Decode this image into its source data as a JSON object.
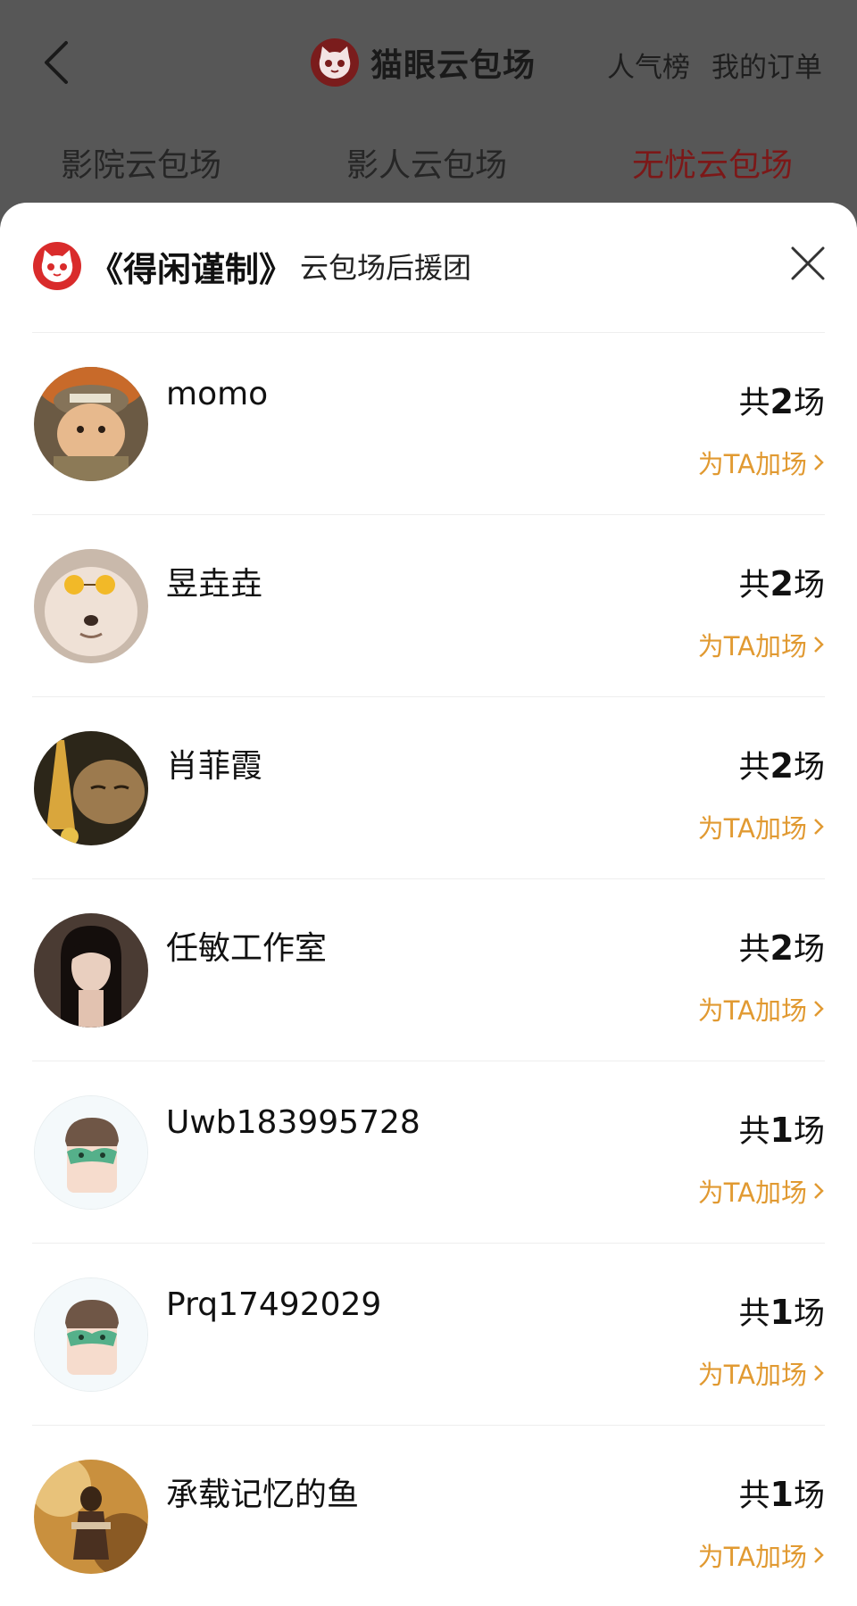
{
  "header": {
    "title": "猫眼云包场",
    "links": [
      "人气榜",
      "我的订单"
    ]
  },
  "tabs": [
    {
      "label": "影院云包场",
      "active": false
    },
    {
      "label": "影人云包场",
      "active": false
    },
    {
      "label": "无忧云包场",
      "active": true
    }
  ],
  "sheet": {
    "title": "《得闲谨制》",
    "subtitle": "云包场后援团"
  },
  "supporters": [
    {
      "name": "momo",
      "count_prefix": "共",
      "count": "2",
      "count_suffix": "场",
      "action": "为TA加场",
      "avatar": "cat-soldier-photo"
    },
    {
      "name": "昱垚垚",
      "count_prefix": "共",
      "count": "2",
      "count_suffix": "场",
      "action": "为TA加场",
      "avatar": "cat-sunglasses-photo"
    },
    {
      "name": "肖菲霞",
      "count_prefix": "共",
      "count": "2",
      "count_suffix": "场",
      "action": "为TA加场",
      "avatar": "cat-eiffel-photo"
    },
    {
      "name": "任敏工作室",
      "count_prefix": "共",
      "count": "2",
      "count_suffix": "场",
      "action": "为TA加场",
      "avatar": "woman-portrait-photo"
    },
    {
      "name": "Uwb183995728",
      "count_prefix": "共",
      "count": "1",
      "count_suffix": "场",
      "action": "为TA加场",
      "avatar": "default-masked-avatar"
    },
    {
      "name": "Prq17492029",
      "count_prefix": "共",
      "count": "1",
      "count_suffix": "场",
      "action": "为TA加场",
      "avatar": "default-masked-avatar"
    },
    {
      "name": "承载记忆的鱼",
      "count_prefix": "共",
      "count": "1",
      "count_suffix": "场",
      "action": "为TA加场",
      "avatar": "autumn-forest-photo"
    }
  ],
  "colors": {
    "top_bar": "#575757",
    "active_tab": "#7c1818",
    "accent_orange": "#e19a32",
    "brand_red": "#d92b2b"
  }
}
